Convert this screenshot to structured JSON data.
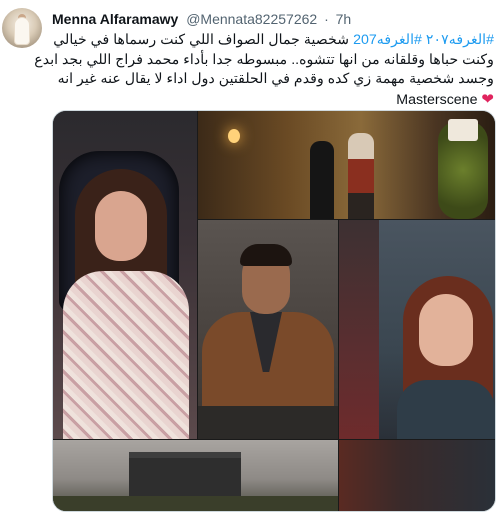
{
  "tweet": {
    "display_name": "Menna Alfaramawy",
    "handle": "@Mennata82257262",
    "separator": "·",
    "time": "7h",
    "text_line1_hashtags": "#الغرفه٢٠٧ #الغرفه207",
    "text_line1_rest": " شخصية جمال الصواف اللي كنت رسماها في خيالي",
    "text_line2": "وكنت حباها وقلقانه من انها تتشوه.. مبسوطه جدا بأداء محمد فراج اللي بجد ابدع",
    "text_line3": "وجسد شخصية مهمة زي كده وقدم في الحلقتين دول اداء لا يقال عنه غير انه",
    "text_line4": "Masterscene",
    "heart": "❤"
  },
  "icons": {
    "avatar": "profile-avatar",
    "heart": "red-heart-emoji"
  },
  "colors": {
    "link": "#1d9bf0",
    "secondary_text": "#536471",
    "heart": "#e0245e",
    "border": "#cfd9de"
  }
}
